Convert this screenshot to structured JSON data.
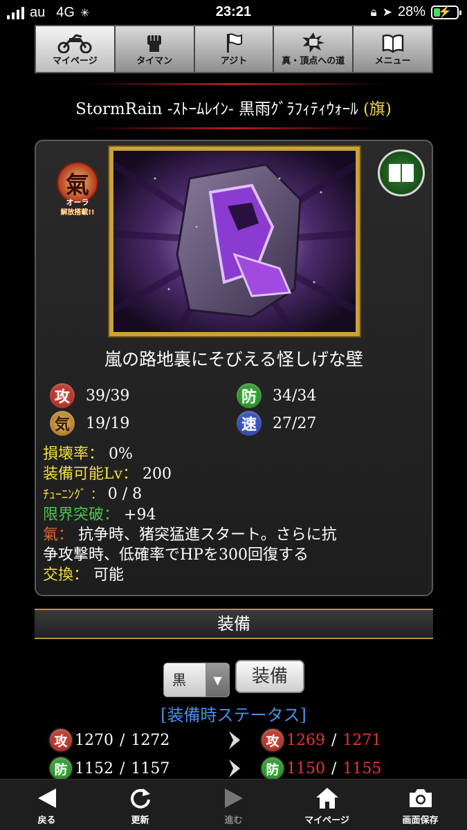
{
  "status_bar": {
    "carrier": "au",
    "network": "4G",
    "time": "23:21",
    "battery": "28%",
    "battery_level": 0.28
  },
  "top_nav": {
    "tabs": [
      {
        "label": "マイページ",
        "icon": "motorcycle-icon"
      },
      {
        "label": "タイマン",
        "icon": "fist-icon"
      },
      {
        "label": "アジト",
        "icon": "flag-icon"
      },
      {
        "label": "真・頂点への道",
        "icon": "burst-fist-icon"
      },
      {
        "label": "メニュー",
        "icon": "book-icon"
      }
    ]
  },
  "item": {
    "title": "StormRain -ｽﾄｰﾑﾚｲﾝ- 黒雨ｸﾞﾗﾌｨﾃｨｳｫｰﾙ",
    "title_suffix": "(旗)",
    "aura_badge": {
      "char": "氣",
      "line1": "オーラ",
      "line2": "解放搭載!!"
    },
    "description": "嵐の路地裏にそびえる怪しげな壁",
    "stats": {
      "atk": {
        "label": "攻",
        "value": "39/39"
      },
      "def": {
        "label": "防",
        "value": "34/34"
      },
      "ki": {
        "label": "気",
        "value": "19/19"
      },
      "spd": {
        "label": "速",
        "value": "27/27"
      }
    },
    "damage_rate": {
      "label": "損壊率：",
      "value": "0%"
    },
    "equip_level": {
      "label": "装備可能Lv：",
      "value": "200"
    },
    "tuning": {
      "label": "ﾁｭｰﾆﾝｸﾞ ：",
      "value": "0 / 8"
    },
    "limit_break": {
      "label": "限界突破：",
      "value": "+94"
    },
    "aura": {
      "label": "氣：",
      "value_line1": "抗争時、猪突猛進スタート。さらに抗",
      "value_line2": "争攻撃時、低確率でHPを300回復する"
    },
    "exchange": {
      "label": "交換：",
      "value": "可能"
    }
  },
  "equip": {
    "section_label": "装備",
    "select_value": "黒",
    "button_label": "装備",
    "status_header": "[装備時ステータス]",
    "rows": [
      {
        "label": "攻",
        "current_a": "1270",
        "current_b": "1272",
        "new_a": "1269",
        "new_b": "1271"
      },
      {
        "label": "防",
        "current_a": "1152",
        "current_b": "1157",
        "new_a": "1150",
        "new_b": "1155"
      }
    ],
    "separator": " / "
  },
  "bottom_bar": {
    "back": "戻る",
    "refresh": "更新",
    "forward": "進む",
    "mypage": "マイページ",
    "save_screen": "画面保存"
  }
}
